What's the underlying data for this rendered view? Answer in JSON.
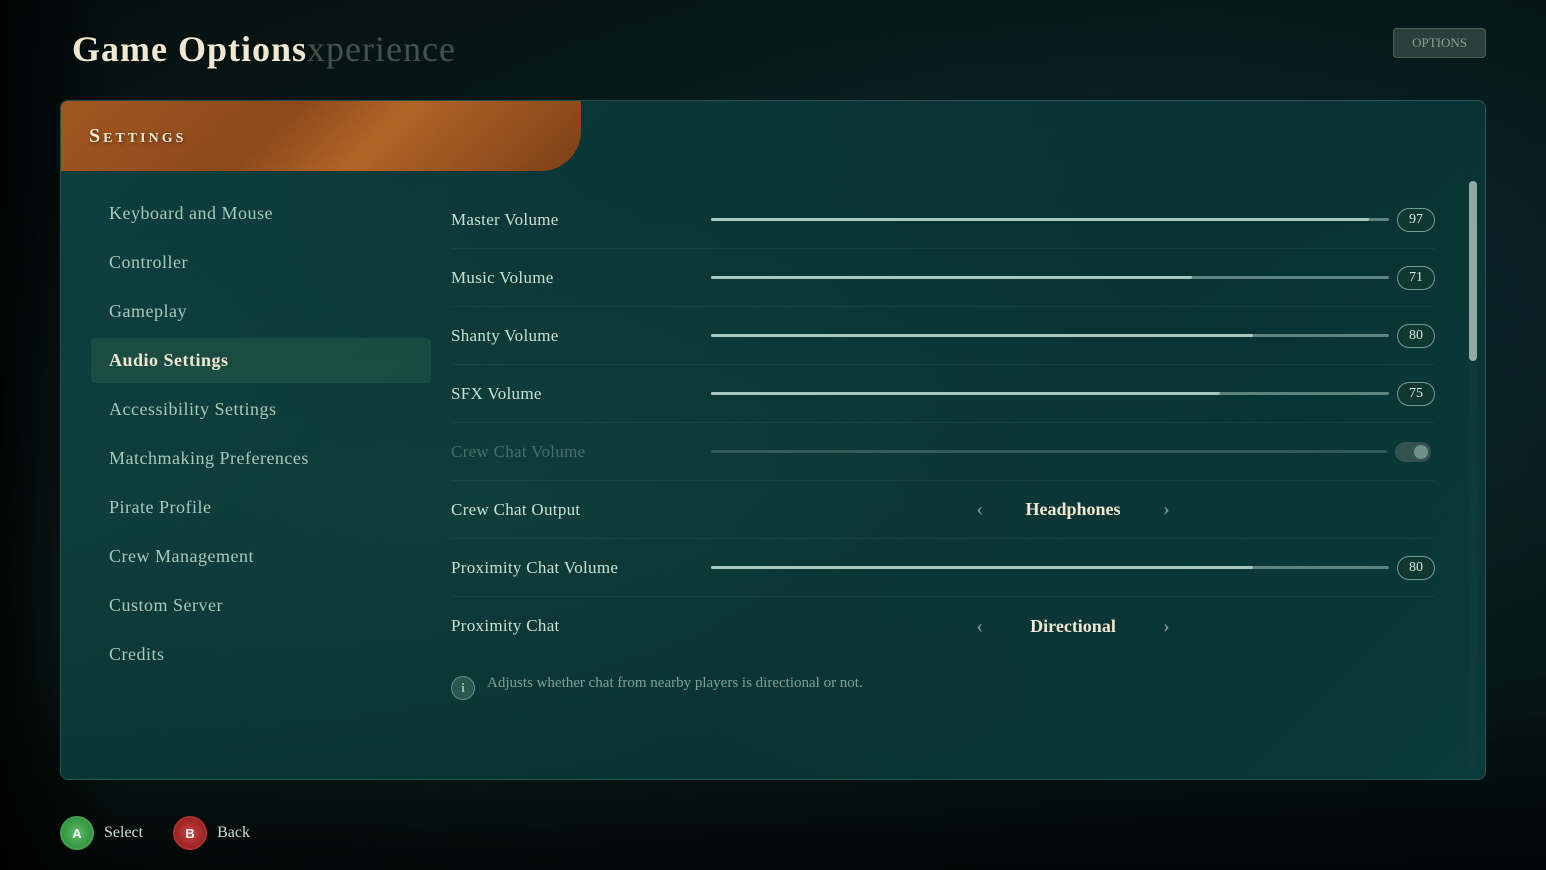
{
  "page": {
    "title_main": "Game Options",
    "title_sub": "xperience",
    "top_right_btn": "OPTIONS"
  },
  "settings_tab": {
    "label": "Settings"
  },
  "nav": {
    "items": [
      {
        "id": "keyboard-mouse",
        "label": "Keyboard and Mouse",
        "active": false
      },
      {
        "id": "controller",
        "label": "Controller",
        "active": false
      },
      {
        "id": "gameplay",
        "label": "Gameplay",
        "active": false
      },
      {
        "id": "audio-settings",
        "label": "Audio Settings",
        "active": true
      },
      {
        "id": "accessibility-settings",
        "label": "Accessibility Settings",
        "active": false
      },
      {
        "id": "matchmaking-preferences",
        "label": "Matchmaking Preferences",
        "active": false
      },
      {
        "id": "pirate-profile",
        "label": "Pirate Profile",
        "active": false
      },
      {
        "id": "crew-management",
        "label": "Crew Management",
        "active": false
      },
      {
        "id": "custom-server",
        "label": "Custom Server",
        "active": false
      },
      {
        "id": "credits",
        "label": "Credits",
        "active": false
      }
    ]
  },
  "audio_settings": {
    "rows": [
      {
        "id": "master-volume",
        "label": "Master Volume",
        "type": "slider",
        "value": 97,
        "fill_pct": 97,
        "disabled": false
      },
      {
        "id": "music-volume",
        "label": "Music Volume",
        "type": "slider",
        "value": 71,
        "fill_pct": 71,
        "disabled": false
      },
      {
        "id": "shanty-volume",
        "label": "Shanty Volume",
        "type": "slider",
        "value": 80,
        "fill_pct": 80,
        "disabled": false
      },
      {
        "id": "sfx-volume",
        "label": "SFX Volume",
        "type": "slider",
        "value": 75,
        "fill_pct": 75,
        "disabled": false
      },
      {
        "id": "crew-chat-volume",
        "label": "Crew Chat Volume",
        "type": "toggle-disabled",
        "disabled": true
      },
      {
        "id": "crew-chat-output",
        "label": "Crew Chat Output",
        "type": "selector",
        "value": "Headphones",
        "disabled": false
      },
      {
        "id": "proximity-chat-volume",
        "label": "Proximity Chat Volume",
        "type": "slider",
        "value": 80,
        "fill_pct": 80,
        "disabled": false
      },
      {
        "id": "proximity-chat",
        "label": "Proximity Chat",
        "type": "selector",
        "value": "Directional",
        "disabled": false
      }
    ],
    "info_text": "Adjusts whether chat from nearby players is directional or not."
  },
  "bottom_bar": {
    "select_btn": {
      "label": "A",
      "text": "Select"
    },
    "back_btn": {
      "label": "B",
      "text": "Back"
    }
  }
}
